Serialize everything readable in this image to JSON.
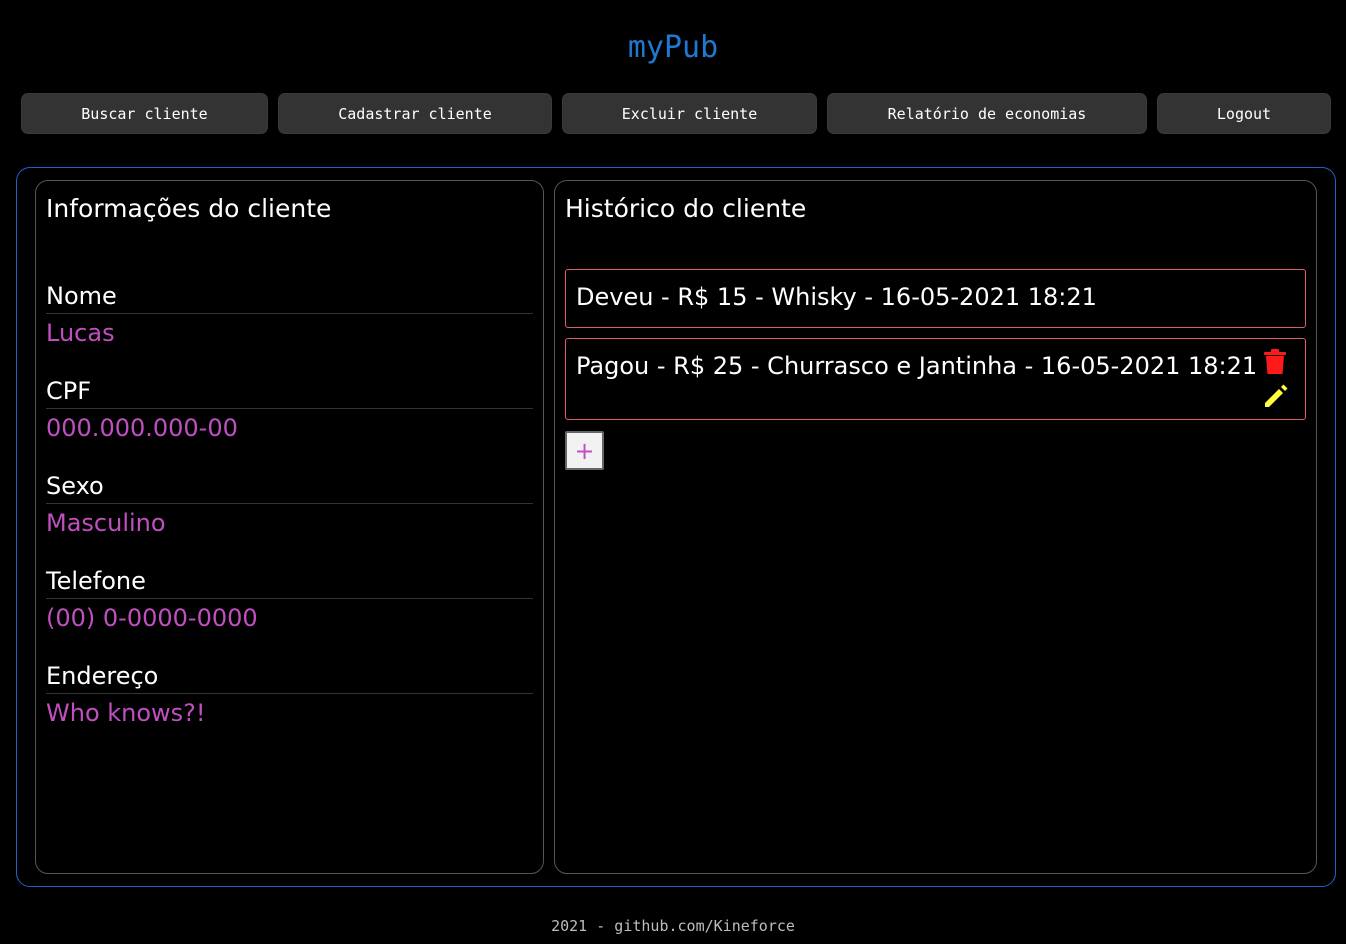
{
  "app": {
    "title": "myPub"
  },
  "nav": {
    "search": "Buscar cliente",
    "register": "Cadastrar cliente",
    "delete": "Excluir cliente",
    "report": "Relatório de economias",
    "logout": "Logout"
  },
  "client_info": {
    "title": "Informações do cliente",
    "fields": [
      {
        "label": "Nome",
        "value": "Lucas"
      },
      {
        "label": "CPF",
        "value": "000.000.000-00"
      },
      {
        "label": "Sexo",
        "value": "Masculino"
      },
      {
        "label": "Telefone",
        "value": "(00) 0-0000-0000"
      },
      {
        "label": "Endereço",
        "value": "Who knows?!"
      }
    ]
  },
  "history": {
    "title": "Histórico do cliente",
    "items": [
      {
        "text": "Deveu - R$ 15 - Whisky - 16-05-2021 18:21"
      },
      {
        "text": "Pagou - R$ 25 - Churrasco e Jantinha - 16-05-2021 18:21",
        "icons": [
          "trash-icon",
          "pencil-icon"
        ]
      }
    ],
    "add_label": "+"
  },
  "colors": {
    "accent_title": "#1f78d1",
    "field_value": "#c04fc0",
    "item_border": "#e05a70",
    "trash": "#ff1a1a",
    "pencil": "#ffff40",
    "main_border": "#2460c8"
  },
  "footer": {
    "text": "2021 - github.com/Kineforce"
  }
}
